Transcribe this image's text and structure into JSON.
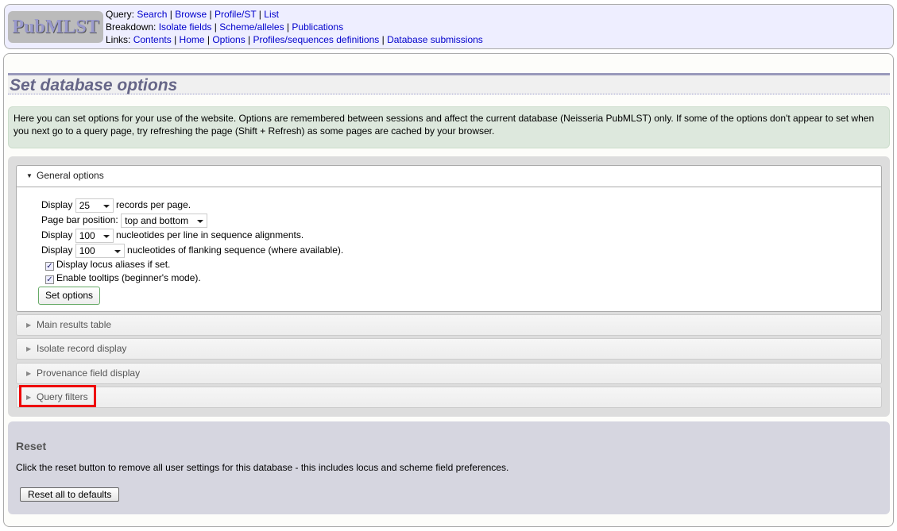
{
  "header": {
    "logo": "PubMLST",
    "query_label": "Query:",
    "query_links": [
      "Search",
      "Browse",
      "Profile/ST",
      "List"
    ],
    "breakdown_label": "Breakdown:",
    "breakdown_links": [
      "Isolate fields",
      "Scheme/alleles",
      "Publications"
    ],
    "links_label": "Links:",
    "links": [
      "Contents",
      "Home",
      "Options",
      "Profiles/sequences definitions",
      "Database submissions"
    ]
  },
  "page_title": "Set database options",
  "info": "Here you can set options for your use of the website. Options are remembered between sessions and affect the current database (Neisseria PubMLST) only. If some of the options don't appear to set when you next go to a query page, try refreshing the page (Shift + Refresh) as some pages are cached by your browser.",
  "general": {
    "title": "General options",
    "display": "Display",
    "records_value": "25",
    "records_suffix": "records per page.",
    "pagebar_label": "Page bar position:",
    "pagebar_value": "top and bottom",
    "nuc_value": "100",
    "nuc_suffix": "nucleotides per line in sequence alignments.",
    "flank_value": "100",
    "flank_suffix": "nucleotides of flanking sequence (where available).",
    "aliases": "Display locus aliases if set.",
    "aliases_checked": true,
    "tooltips": "Enable tooltips (beginner's mode).",
    "tooltips_checked": true,
    "set_button": "Set options"
  },
  "sections": [
    "Main results table",
    "Isolate record display",
    "Provenance field display",
    "Query filters"
  ],
  "reset": {
    "title": "Reset",
    "text": "Click the reset button to remove all user settings for this database - this includes locus and scheme field preferences.",
    "button": "Reset all to defaults"
  },
  "highlight_color": "#ee0000"
}
